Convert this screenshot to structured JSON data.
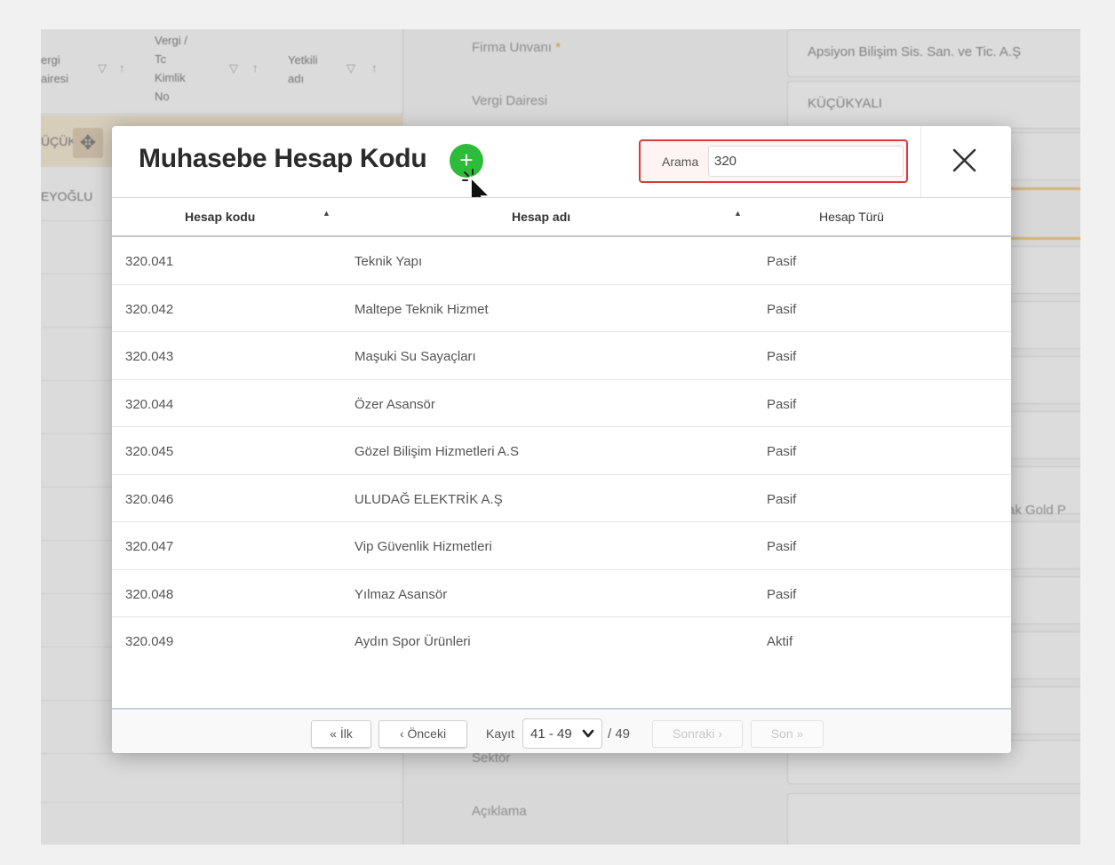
{
  "background": {
    "left_headers": [
      "ergi\nairesi",
      "Vergi /\nTc\nKimlik\nNo",
      "Yetkili\nadı"
    ],
    "left_rows": [
      "ÜÇÜKYALI",
      "EYOĞLU"
    ],
    "fields": [
      {
        "label": "Firma Unvanı",
        "required": "*",
        "value": "Apsiyon Bilişim Sis. San. ve Tic. A.Ş"
      },
      {
        "label": "Vergi Dairesi",
        "value": "KÜÇÜKYALI"
      },
      {
        "label": "Sektör",
        "value": ""
      },
      {
        "label": "Açıklama",
        "value": ""
      }
    ],
    "side_text": "ak Gold P"
  },
  "modal": {
    "title": "Muhasebe Hesap Kodu",
    "add_icon": "plus-icon",
    "search": {
      "label": "Arama",
      "value": "320"
    },
    "close_icon": "close-icon",
    "columns": [
      "Hesap kodu",
      "Hesap adı",
      "Hesap Türü"
    ],
    "rows": [
      {
        "code": "320.041",
        "name": "Teknik Yapı",
        "type": "Pasif"
      },
      {
        "code": "320.042",
        "name": "Maltepe Teknik Hizmet",
        "type": "Pasif"
      },
      {
        "code": "320.043",
        "name": "Maşuki Su Sayaçları",
        "type": "Pasif"
      },
      {
        "code": "320.044",
        "name": "Özer Asansör",
        "type": "Pasif"
      },
      {
        "code": "320.045",
        "name": "Gözel Bilişim Hizmetleri A.S",
        "type": "Pasif"
      },
      {
        "code": "320.046",
        "name": "ULUDAĞ ELEKTRİK A.Ş",
        "type": "Pasif"
      },
      {
        "code": "320.047",
        "name": "Vip Güvenlik Hizmetleri",
        "type": "Pasif"
      },
      {
        "code": "320.048",
        "name": "Yılmaz Asansör",
        "type": "Pasif"
      },
      {
        "code": "320.049",
        "name": "Aydın Spor Ürünleri",
        "type": "Aktif"
      }
    ],
    "pagination": {
      "first": "« İlk",
      "prev": "‹ Önceki",
      "record_label": "Kayıt",
      "range": "41 - 49",
      "total": "/ 49",
      "next": "Sonraki ›",
      "last": "Son »"
    }
  },
  "colors": {
    "add_button": "#2dbb3a",
    "search_border": "#d8393d",
    "highlight_row": "#f3e5cc"
  }
}
